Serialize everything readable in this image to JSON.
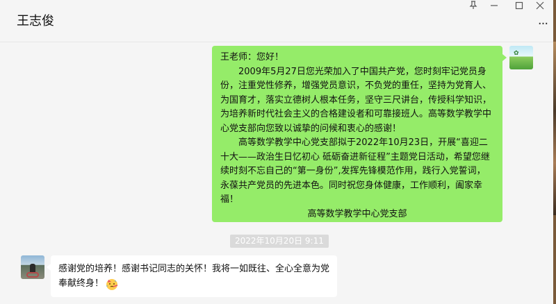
{
  "header": {
    "contact_name": "王志俊",
    "pin_icon": "pin-icon",
    "minimize_icon": "minimize-icon",
    "maximize_icon": "maximize-icon",
    "close_icon": "close-icon",
    "more_icon": "more-options-icon"
  },
  "messages": {
    "outgoing": {
      "greeting": "王老师：您好！",
      "para1": "2009年5月27日您光荣加入了中国共产党，您时刻牢记党员身份，注重党性修养，增强党员意识，不负党的重任，坚持为党育人、为国育才，落实立德树人根本任务，坚守三尺讲台，传授科学知识，为培养新时代社会主义的合格建设者和可靠接班人。高等数学教学中心党支部向您致以诚挚的问候和衷心的感谢！",
      "para2": "高等数学教学中心党支部拟于2022年10月23日，开展“喜迎二十大——政治生日忆初心 砥砺奋进新征程”主题党日活动，希望您继续时刻不忘自己的“第一身份”,发挥先锋模范作用，践行入党誓词，永葆共产党员的先进本色。同时祝您身体健康，工作顺利，阖家幸福！",
      "signature": "高等数学教学中心党支部"
    },
    "timestamp": "2022年10月20日 9:11",
    "incoming": {
      "text": "感谢党的培养！感谢书记同志的关怀！我将一如既往、全心全意为党奉献终身！",
      "emoji": "party-face-emoji"
    }
  },
  "colors": {
    "outgoing_bubble": "#95ec69",
    "incoming_bubble": "#ffffff",
    "background": "#f5f5f5"
  }
}
